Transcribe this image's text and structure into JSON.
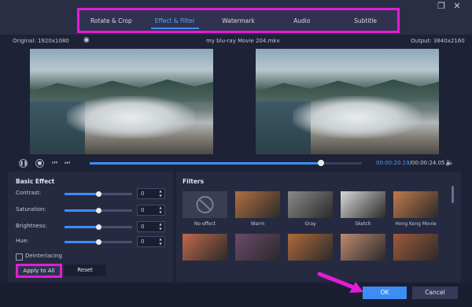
{
  "tabs": [
    {
      "label": "Rotate & Crop"
    },
    {
      "label": "Effect & Filter"
    },
    {
      "label": "Watermark"
    },
    {
      "label": "Audio"
    },
    {
      "label": "Subtitle"
    }
  ],
  "active_tab": "Effect & Filter",
  "info": {
    "original": "Original: 1920x1080",
    "filename": "my blu-ray Movie 204.mkv",
    "output": "Output: 3840x2160"
  },
  "playback": {
    "current_time": "00:00:20.19",
    "total_time": "/00:00:24.05",
    "progress": 0.85
  },
  "basic_effect": {
    "title": "Basic Effect",
    "rows": [
      {
        "label": "Contrast:",
        "value": "0",
        "level": 0.5
      },
      {
        "label": "Saturation:",
        "value": "0",
        "level": 0.5
      },
      {
        "label": "Brightness:",
        "value": "0",
        "level": 0.5
      },
      {
        "label": "Hue:",
        "value": "0",
        "level": 0.5
      }
    ],
    "deinterlacing_label": "Deinterlacing",
    "apply_all_label": "Apply to All",
    "reset_label": "Reset"
  },
  "filters": {
    "title": "Filters",
    "items": [
      {
        "label": "No effect",
        "color": "#3a3e52"
      },
      {
        "label": "Warm",
        "color": "#b07040"
      },
      {
        "label": "Gray",
        "color": "#8a8a8a"
      },
      {
        "label": "Sketch",
        "color": "#d8d8d8"
      },
      {
        "label": "Hong Kong Movie",
        "color": "#c07a4a"
      }
    ],
    "row2_colors": [
      "#c06a4a",
      "#6a4a6a",
      "#b06a3a",
      "#c08a70",
      "#a05a3a"
    ]
  },
  "footer": {
    "ok_label": "OK",
    "cancel_label": "Cancel"
  },
  "accent": "#3d8df5",
  "highlight": "#e51bd6"
}
